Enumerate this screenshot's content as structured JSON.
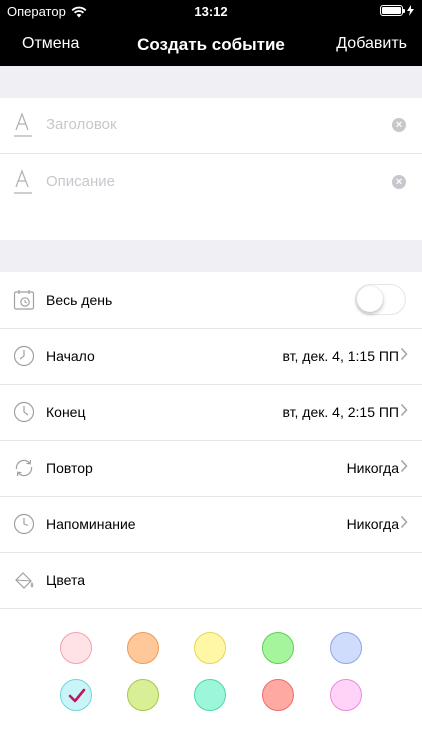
{
  "status_bar": {
    "carrier": "Оператор",
    "time": "13:12"
  },
  "nav": {
    "cancel_label": "Отмена",
    "title": "Создать событие",
    "add_label": "Добавить"
  },
  "fields": {
    "title_placeholder": "Заголовок",
    "description_placeholder": "Описание"
  },
  "rows": {
    "all_day": {
      "label": "Весь день",
      "on": false
    },
    "start": {
      "label": "Начало",
      "value": "вт, дек. 4, 1:15 ПП"
    },
    "end": {
      "label": "Конец",
      "value": "вт, дек. 4, 2:15 ПП"
    },
    "repeat": {
      "label": "Повтор",
      "value": "Никогда"
    },
    "reminder": {
      "label": "Напоминание",
      "value": "Никогда"
    },
    "colors": {
      "label": "Цвета"
    }
  },
  "colors": {
    "accent": "#000000",
    "swatches": [
      {
        "fill": "#fde3e6",
        "border": "#f5a0ac",
        "selected": false
      },
      {
        "fill": "#ffc89a",
        "border": "#f09a55",
        "selected": false
      },
      {
        "fill": "#fff7a6",
        "border": "#e6d65a",
        "selected": false
      },
      {
        "fill": "#a5f59d",
        "border": "#5fcf57",
        "selected": false
      },
      {
        "fill": "#d0dcfb",
        "border": "#8ea5ea",
        "selected": false
      },
      {
        "fill": "#c9f5f9",
        "border": "#6fd4e0",
        "selected": true
      },
      {
        "fill": "#d8ef95",
        "border": "#a7c84d",
        "selected": false
      },
      {
        "fill": "#9cf7da",
        "border": "#4fd6ad",
        "selected": false
      },
      {
        "fill": "#ffa9a3",
        "border": "#ef6c64",
        "selected": false
      },
      {
        "fill": "#ffd3f7",
        "border": "#e98ad8",
        "selected": false
      }
    ],
    "check_color": "#c2185b"
  }
}
